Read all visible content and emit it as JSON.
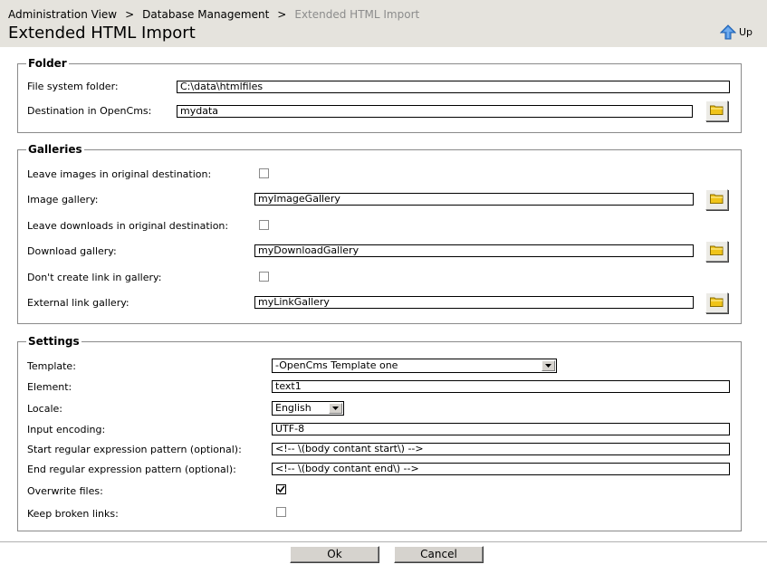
{
  "breadcrumb": {
    "items": [
      "Administration View",
      "Database Management"
    ],
    "separator": ">",
    "current": "Extended HTML Import"
  },
  "page_title": "Extended HTML Import",
  "up_label": "Up",
  "folder": {
    "legend": "Folder",
    "fs_label": "File system folder:",
    "fs_value": "C:\\data\\htmlfiles",
    "dest_label": "Destination in OpenCms:",
    "dest_value": "mydata"
  },
  "galleries": {
    "legend": "Galleries",
    "leave_images_label": "Leave images in original destination:",
    "leave_images_checked": false,
    "image_gallery_label": "Image gallery:",
    "image_gallery_value": "myImageGallery",
    "leave_downloads_label": "Leave downloads in original destination:",
    "leave_downloads_checked": false,
    "download_gallery_label": "Download gallery:",
    "download_gallery_value": "myDownloadGallery",
    "no_link_label": "Don't create link in gallery:",
    "no_link_checked": false,
    "external_link_label": "External link gallery:",
    "external_link_value": "myLinkGallery"
  },
  "settings": {
    "legend": "Settings",
    "template_label": "Template:",
    "template_value": "-OpenCms Template one",
    "element_label": "Element:",
    "element_value": "text1",
    "locale_label": "Locale:",
    "locale_value": "English",
    "encoding_label": "Input encoding:",
    "encoding_value": "UTF-8",
    "start_label": "Start regular expression pattern (optional):",
    "start_value": "<!-- \\(body contant start\\) -->",
    "end_label": "End regular expression pattern (optional):",
    "end_value": "<!-- \\(body contant end\\) -->",
    "overwrite_label": "Overwrite files:",
    "overwrite_checked": true,
    "broken_label": "Keep broken links:",
    "broken_checked": false
  },
  "buttons": {
    "ok": "Ok",
    "cancel": "Cancel"
  },
  "colors": {
    "header_bg": "#e5e3dd",
    "button_bg": "#d6d3ce",
    "folder_icon": "#f0c419"
  },
  "icons": {
    "up": "up-arrow-icon",
    "folder": "folder-icon",
    "dropdown": "chevron-down-icon",
    "check": "checkmark-icon"
  }
}
